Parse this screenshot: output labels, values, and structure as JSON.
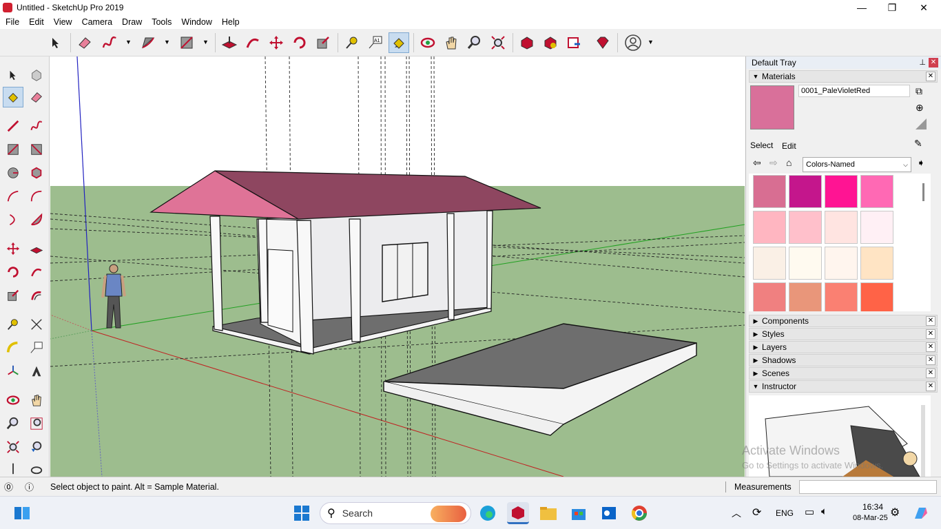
{
  "window": {
    "title": "Untitled - SketchUp Pro 2019",
    "minimize": "—",
    "restore": "❐",
    "close": "✕"
  },
  "menu": [
    "File",
    "Edit",
    "View",
    "Camera",
    "Draw",
    "Tools",
    "Window",
    "Help"
  ],
  "tray": {
    "title": "Default Tray",
    "materials": {
      "header": "Materials",
      "current_name": "0001_PaleVioletRed",
      "current_color": "#d9709a",
      "tabs": {
        "select": "Select",
        "edit": "Edit"
      },
      "collection": "Colors-Named",
      "swatches": [
        "#d86e92",
        "#c4168c",
        "#ff1493",
        "#ff69b4",
        "#ffb6c1",
        "#ffc0cb",
        "#ffe4e1",
        "#fff0f5",
        "#faf0e6",
        "#fffaf0",
        "#fff5ee",
        "#ffe4c4",
        "#f08080",
        "#e9967a",
        "#fa8072",
        "#ff6347"
      ]
    },
    "panels": [
      "Components",
      "Styles",
      "Layers",
      "Shadows",
      "Scenes",
      "Instructor"
    ],
    "watermark_line1": "Activate Windows",
    "watermark_line2": "Go to Settings to activate Windows."
  },
  "status": {
    "message": "Select object to paint. Alt = Sample Material.",
    "measurements_label": "Measurements",
    "measurements_value": ""
  },
  "taskbar": {
    "search_placeholder": "Search",
    "language": "ENG",
    "time": "16:34",
    "date": "08-Mar-25"
  },
  "colors": {
    "roof_front": "#df7397",
    "roof_main": "#8e4660",
    "ground": "#9dbd8e",
    "sky": "#ffffff",
    "wall": "#ececee",
    "slab": "#6e6e6e"
  }
}
